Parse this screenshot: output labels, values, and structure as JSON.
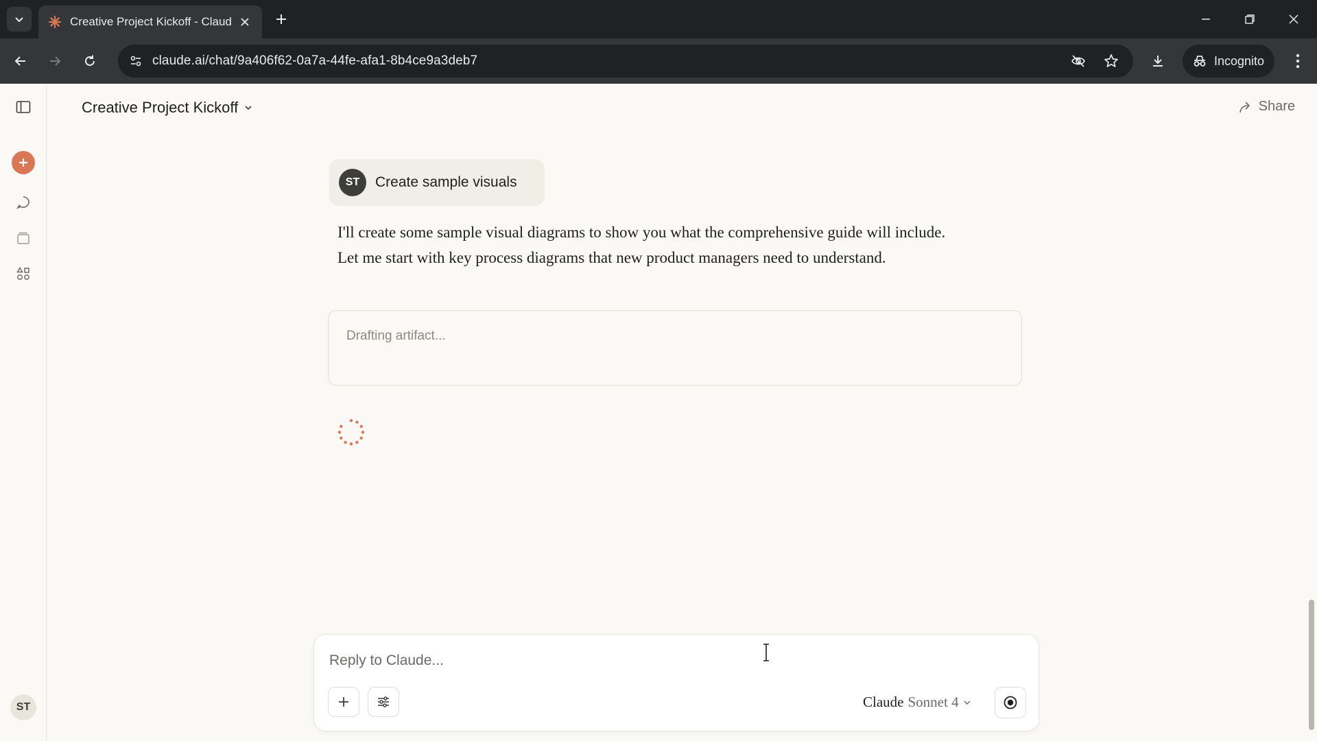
{
  "browser": {
    "tab_title": "Creative Project Kickoff - Claude",
    "url": "claude.ai/chat/9a406f62-0a7a-44fe-afa1-8b4ce9a3deb7",
    "incognito_label": "Incognito"
  },
  "header": {
    "title": "Creative Project Kickoff",
    "share_label": "Share"
  },
  "sidebar": {
    "user_initials": "ST"
  },
  "conversation": {
    "user_initials": "ST",
    "user_message": "Create sample visuals",
    "assistant_message": "I'll create some sample visual diagrams to show you what the comprehensive guide will include. Let me start with key process diagrams that new product managers need to understand.",
    "artifact_status": "Drafting artifact..."
  },
  "composer": {
    "placeholder": "Reply to Claude...",
    "model_name": "Claude",
    "model_version": "Sonnet 4"
  },
  "colors": {
    "accent": "#d97757",
    "background": "#faf9f5",
    "chrome_dark": "#202124",
    "chrome_mid": "#35363a"
  }
}
